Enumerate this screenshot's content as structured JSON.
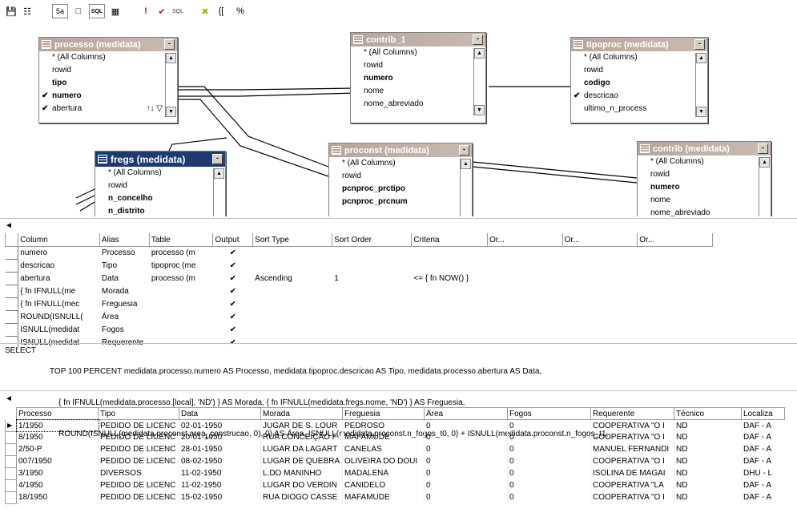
{
  "toolbar": {
    "icons": [
      "save-icon",
      "properties-icon",
      "show-diagram-icon",
      "show-grid-icon",
      "show-sql-icon",
      "show-results-icon",
      "run-icon",
      "verify-sql-icon",
      "group-by-icon",
      "remove-filter-icon",
      "add-table-icon",
      "new-table-icon"
    ],
    "labels": [
      "",
      "",
      "5a",
      "",
      "SQL",
      "",
      "!",
      "",
      "SQL",
      "",
      "{[",
      "%"
    ]
  },
  "tables": [
    {
      "title": "processo (medidata)",
      "columns": [
        {
          "name": "* (All Columns)",
          "bold": false,
          "checked": false
        },
        {
          "name": "rowid",
          "bold": false,
          "checked": false
        },
        {
          "name": "tipo",
          "bold": true,
          "checked": false
        },
        {
          "name": "numero",
          "bold": true,
          "checked": true
        },
        {
          "name": "abertura",
          "bold": false,
          "checked": true
        }
      ],
      "extra": "↑↓ ▽"
    },
    {
      "title": "contrib_1",
      "columns": [
        {
          "name": "* (All Columns)",
          "bold": false,
          "checked": false
        },
        {
          "name": "rowid",
          "bold": false,
          "checked": false
        },
        {
          "name": "numero",
          "bold": true,
          "checked": false
        },
        {
          "name": "nome",
          "bold": false,
          "checked": false
        },
        {
          "name": "nome_abreviado",
          "bold": false,
          "checked": false
        }
      ]
    },
    {
      "title": "tipoproc (medidata)",
      "columns": [
        {
          "name": "* (All Columns)",
          "bold": false,
          "checked": false
        },
        {
          "name": "rowid",
          "bold": false,
          "checked": false
        },
        {
          "name": "codigo",
          "bold": true,
          "checked": false
        },
        {
          "name": "descricao",
          "bold": false,
          "checked": true
        },
        {
          "name": "ultimo_n_process",
          "bold": false,
          "checked": false
        }
      ]
    },
    {
      "title": "fregs (medidata)",
      "columns": [
        {
          "name": "* (All Columns)",
          "bold": false,
          "checked": false
        },
        {
          "name": "rowid",
          "bold": false,
          "checked": false
        },
        {
          "name": "n_concelho",
          "bold": true,
          "checked": false
        },
        {
          "name": "n_distrito",
          "bold": true,
          "checked": false
        }
      ]
    },
    {
      "title": "proconst (medidata)",
      "columns": [
        {
          "name": "* (All Columns)",
          "bold": false,
          "checked": false
        },
        {
          "name": "rowid",
          "bold": false,
          "checked": false
        },
        {
          "name": "pcnproc_prctipo",
          "bold": true,
          "checked": false
        },
        {
          "name": "pcnproc_prcnum",
          "bold": true,
          "checked": false
        }
      ]
    },
    {
      "title": "contrib (medidata)",
      "columns": [
        {
          "name": "* (All Columns)",
          "bold": false,
          "checked": false
        },
        {
          "name": "rowid",
          "bold": false,
          "checked": false
        },
        {
          "name": "numero",
          "bold": true,
          "checked": false
        },
        {
          "name": "nome",
          "bold": false,
          "checked": false
        },
        {
          "name": "nome_abreviado",
          "bold": false,
          "checked": false
        }
      ]
    }
  ],
  "nav": {
    "left": "◄"
  },
  "grid": {
    "headers": [
      "Column",
      "Alias",
      "Table",
      "Output",
      "Sort Type",
      "Sort Order",
      "Criteria",
      "Or...",
      "Or...",
      "Or..."
    ],
    "rows": [
      [
        "numero",
        "Processo",
        "processo (m",
        "✔",
        "",
        "",
        "",
        "",
        "",
        ""
      ],
      [
        "descricao",
        "Tipo",
        "tipoproc (me",
        "✔",
        "",
        "",
        "",
        "",
        "",
        ""
      ],
      [
        "abertura",
        "Data",
        "processo (m",
        "✔",
        "Ascending",
        "1",
        "<= { fn NOW() }",
        "",
        "",
        ""
      ],
      [
        "{ fn IFNULL(me",
        "Morada",
        "",
        "✔",
        "",
        "",
        "",
        "",
        "",
        ""
      ],
      [
        "{ fn IFNULL(mec",
        "Freguesia",
        "",
        "✔",
        "",
        "",
        "",
        "",
        "",
        ""
      ],
      [
        "ROUND(ISNULL(",
        "Área",
        "",
        "✔",
        "",
        "",
        "",
        "",
        "",
        ""
      ],
      [
        "ISNULL(medidat",
        "Fogos",
        "",
        "✔",
        "",
        "",
        "",
        "",
        "",
        ""
      ],
      [
        "ISNULL(medidat",
        "Requerente",
        "",
        "✔",
        "",
        "",
        "",
        "",
        "",
        ""
      ]
    ]
  },
  "sql": {
    "keyword": "SELECT",
    "lines": [
      "TOP 100 PERCENT medidata.processo.numero AS Processo, medidata.tipoproc.descricao AS Tipo, medidata.processo.abertura AS Data,",
      "    { fn IFNULL(medidata.processo.[local], 'ND') } AS Morada, { fn IFNULL(medidata.fregs.nome, 'ND') } AS Freguesia,",
      "    ROUND(ISNULL(medidata.proconst.area_construcao, 0), 0) AS Área, ISNULL(medidata.proconst.n_fogos_t0, 0) + ISNULL(medidata.proconst.n_fogos_t1,"
    ]
  },
  "results": {
    "headers": [
      "Processo",
      "Tipo",
      "Data",
      "Morada",
      "Freguesia",
      "Área",
      "Fogos",
      "Requerente",
      "Técnico",
      "Localiza"
    ],
    "rows": [
      [
        "1/1950",
        "PEDIDO DE LICENC",
        "02-01-1950",
        "JUGAR DE S. LOUR",
        "PEDROSO",
        "0",
        "0",
        "COOPERATIVA \"O I",
        "ND",
        "DAF - A"
      ],
      [
        "8/1950",
        "PEDIDO DE LICENC",
        "20-01-1950",
        "RUA CONCEIÇÃO F",
        "MAFAMUDE",
        "0",
        "0",
        "COOPERATIVA \"O I",
        "ND",
        "DAF - A"
      ],
      [
        "2/50-P",
        "PEDIDO DE LICENC",
        "28-01-1950",
        "LUGAR DA LAGART",
        "CANELAS",
        "0",
        "0",
        "MANUEL FERNANDI",
        "ND",
        "DAF - A"
      ],
      [
        "007/1950",
        "PEDIDO DE LICENC",
        "08-02-1950",
        "LUGAR DE QUEBRA",
        "OLIVEIRA DO DOUI",
        "0",
        "0",
        "COOPERATIVA \"O I",
        "ND",
        "DAF - A"
      ],
      [
        "3/1950",
        "DIVERSOS",
        "11-02-1950",
        "L.DO MANINHO",
        "MADALENA",
        "0",
        "0",
        "ISOLINA DE MAGAI",
        "ND",
        "DHU - L"
      ],
      [
        "4/1950",
        "PEDIDO DE LICENC",
        "11-02-1950",
        "LUGAR DO VERDIN",
        "CANIDELO",
        "0",
        "0",
        "COOPERATIVA \"LA",
        "ND",
        "DAF - A"
      ],
      [
        "18/1950",
        "PEDIDO DE LICENC",
        "15-02-1950",
        "RUA DIOGO CASSE",
        "MAFAMUDE",
        "0",
        "0",
        "COOPERATIVA \"O I",
        "ND",
        "DAF - A"
      ]
    ]
  }
}
